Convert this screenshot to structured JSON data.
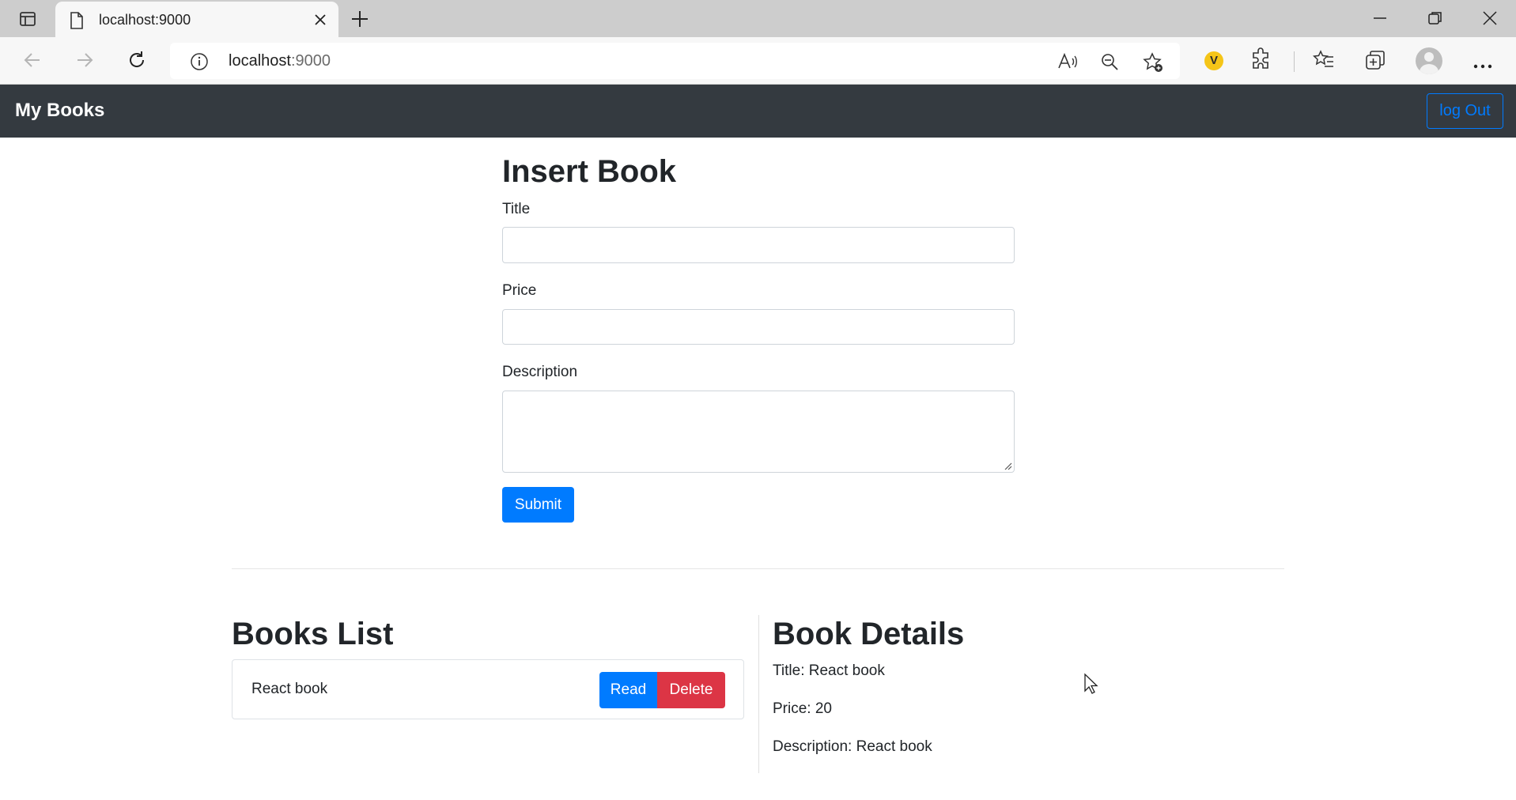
{
  "browser": {
    "tab_title": "localhost:9000",
    "url_host": "localhost",
    "url_port": ":9000"
  },
  "navbar": {
    "brand": "My Books",
    "logout_label": "log Out"
  },
  "insert_form": {
    "heading": "Insert Book",
    "title_label": "Title",
    "title_value": "",
    "price_label": "Price",
    "price_value": "",
    "description_label": "Description",
    "description_value": "",
    "submit_label": "Submit"
  },
  "books_list": {
    "heading": "Books List",
    "items": [
      {
        "title": "React book",
        "read_label": "Read",
        "delete_label": "Delete"
      }
    ]
  },
  "book_details": {
    "heading": "Book Details",
    "title_line": "Title: React book",
    "price_line": "Price: 20",
    "description_line": "Description: React book"
  },
  "colors": {
    "navbar_bg": "#343a40",
    "primary": "#007bff",
    "danger": "#dc3545"
  },
  "icons": [
    "sidebar-toggle-icon",
    "page-icon",
    "close-icon",
    "plus-icon",
    "minimize-icon",
    "restore-icon",
    "back-icon",
    "forward-icon",
    "refresh-icon",
    "info-icon",
    "read-aloud-icon",
    "zoom-out-icon",
    "add-favorite-icon",
    "extension-v-icon",
    "extensions-icon",
    "favorites-icon",
    "collections-icon",
    "profile-icon",
    "more-icon",
    "mouse-cursor-icon"
  ]
}
